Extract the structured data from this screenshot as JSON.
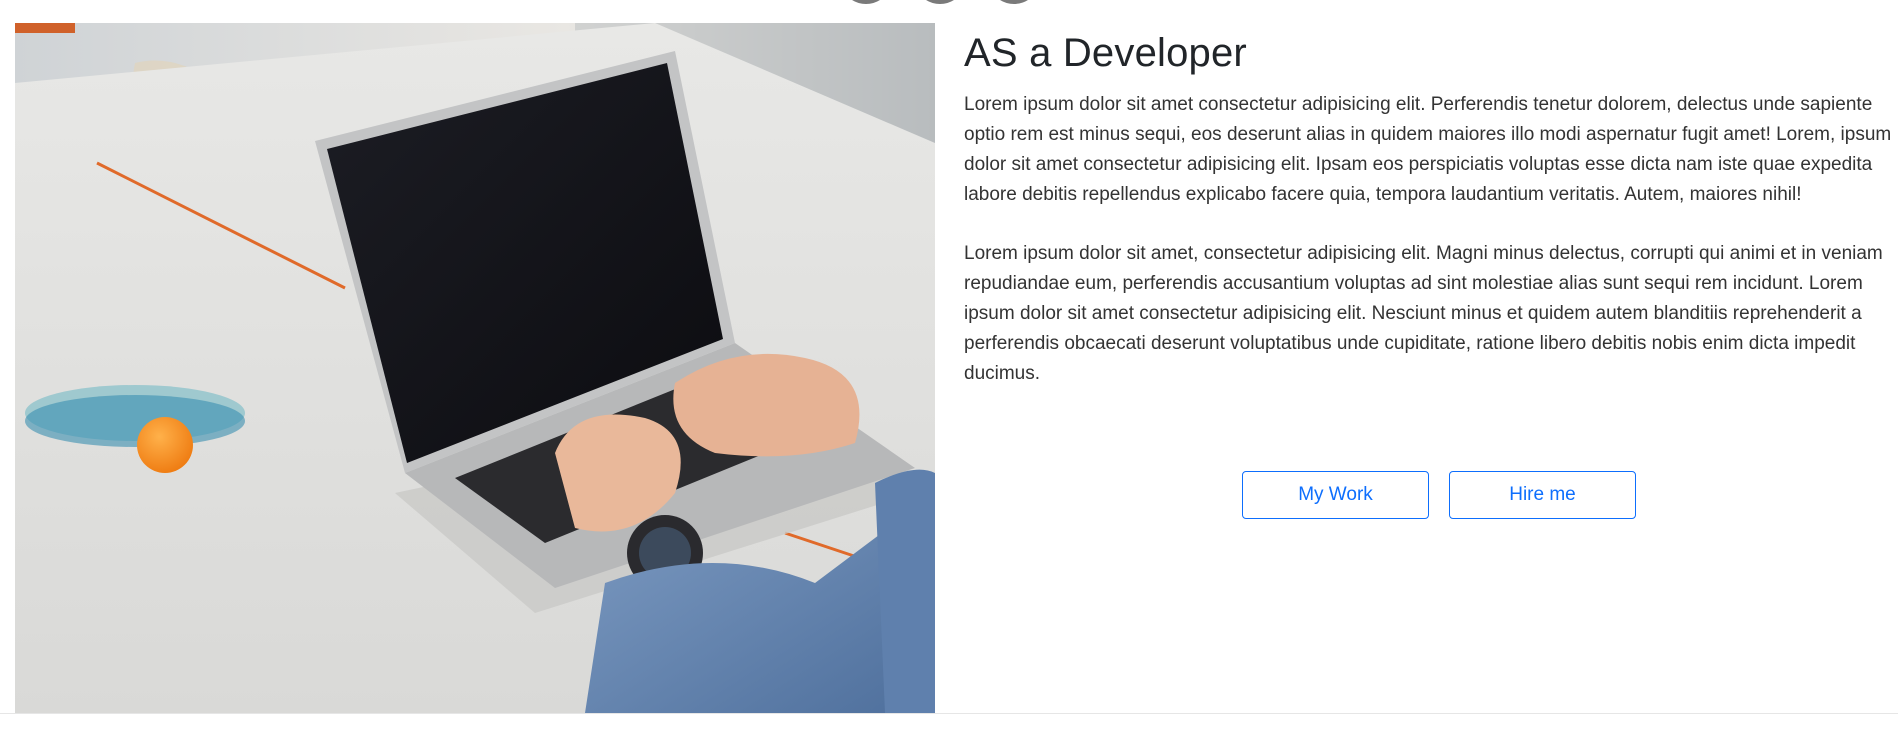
{
  "hero": {
    "title": "AS a Developer",
    "paragraphs": [
      "Lorem ipsum dolor sit amet consectetur adipisicing elit. Perferendis tenetur dolorem, delectus unde sapiente optio rem est minus sequi, eos deserunt alias in quidem maiores illo modi aspernatur fugit amet! Lorem, ipsum dolor sit amet consectetur adipisicing elit. Ipsam eos perspiciatis voluptas esse dicta nam iste quae expedita labore debitis repellendus explicabo facere quia, tempora laudantium veritatis. Autem, maiores nihil!",
      "Lorem ipsum dolor sit amet, consectetur adipisicing elit. Magni minus delectus, corrupti qui animi et in veniam repudiandae eum, perferendis accusantium voluptas ad sint molestiae alias sunt sequi rem incidunt. Lorem ipsum dolor sit amet consectetur adipisicing elit. Nesciunt minus et quidem autem blanditiis reprehenderit a perferendis obcaecati deserunt voluptatibus unde cupiditate, ratione libero debitis nobis enim dicta impedit ducimus."
    ],
    "buttons": {
      "my_work": "My Work",
      "hire_me": "Hire me"
    }
  },
  "colors": {
    "accent": "#0d6efd",
    "heading": "#212529",
    "body_text": "#333333"
  },
  "carousel": {
    "indicator_count": 3
  }
}
